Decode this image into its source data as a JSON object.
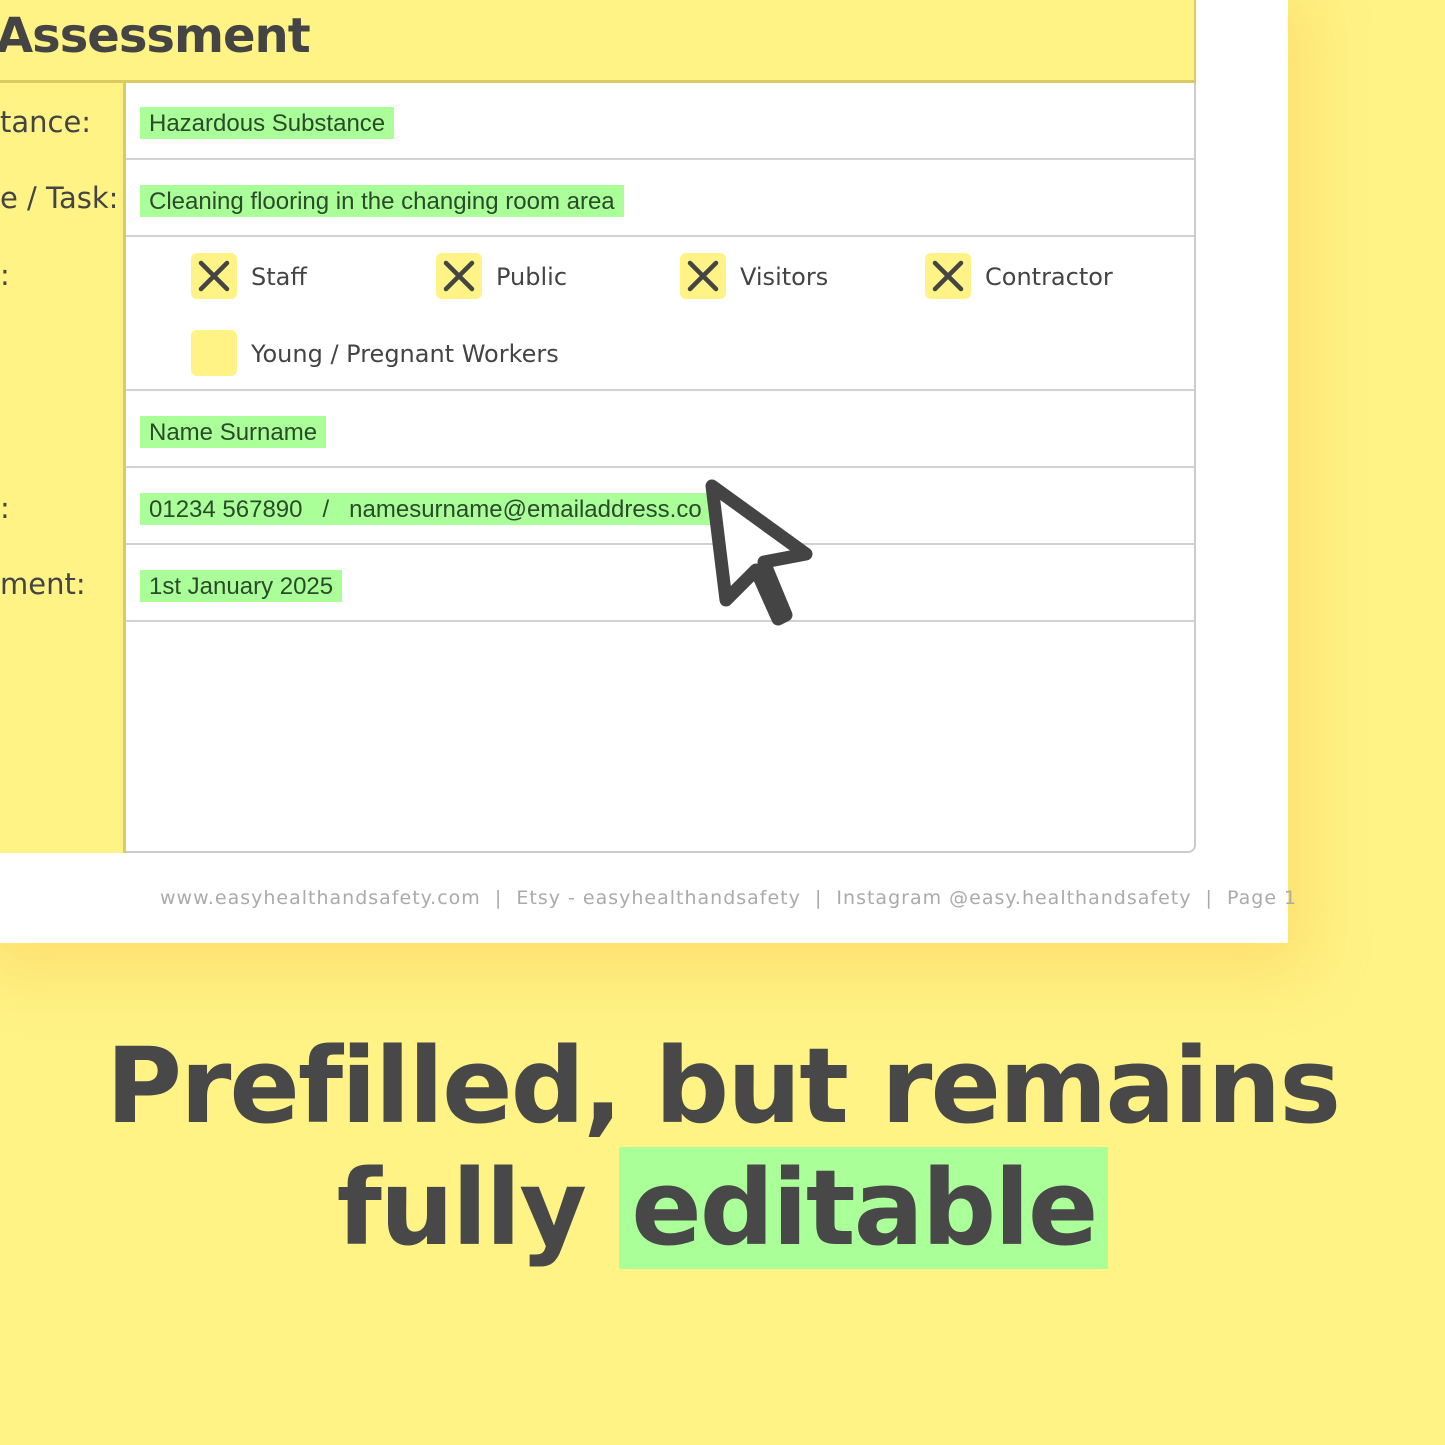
{
  "document": {
    "title": "Assessment",
    "rows": [
      {
        "label": "tance:",
        "value": "Hazardous Substance"
      },
      {
        "label": "e / Task:",
        "value": "Cleaning flooring in the changing room area"
      },
      {
        "label": ":",
        "checkboxes": [
          {
            "label": "Staff",
            "checked": true
          },
          {
            "label": "Public",
            "checked": true
          },
          {
            "label": "Visitors",
            "checked": true
          },
          {
            "label": "Contractor",
            "checked": true
          },
          {
            "label": "Young / Pregnant Workers",
            "checked": false
          }
        ]
      },
      {
        "label": "",
        "value": "Name Surname"
      },
      {
        "label": ":",
        "value": "01234 567890   /   namesurname@emailaddress.co"
      },
      {
        "label": "ment:",
        "value": "1st January 2025"
      }
    ],
    "footer": "www.easyhealthandsafety.com  |  Etsy - easyhealthandsafety  |  Instagram @easy.healthandsafety  |  Page 1"
  },
  "caption": {
    "line1": "Prefilled, but remains",
    "line2_plain": "fully",
    "line2_highlight": "editable"
  },
  "colors": {
    "background": "#FFF386",
    "highlight": "#AAFF99",
    "text": "#444444"
  },
  "icons": {
    "cursor": "mouse-pointer-icon",
    "check": "x-mark-icon"
  }
}
